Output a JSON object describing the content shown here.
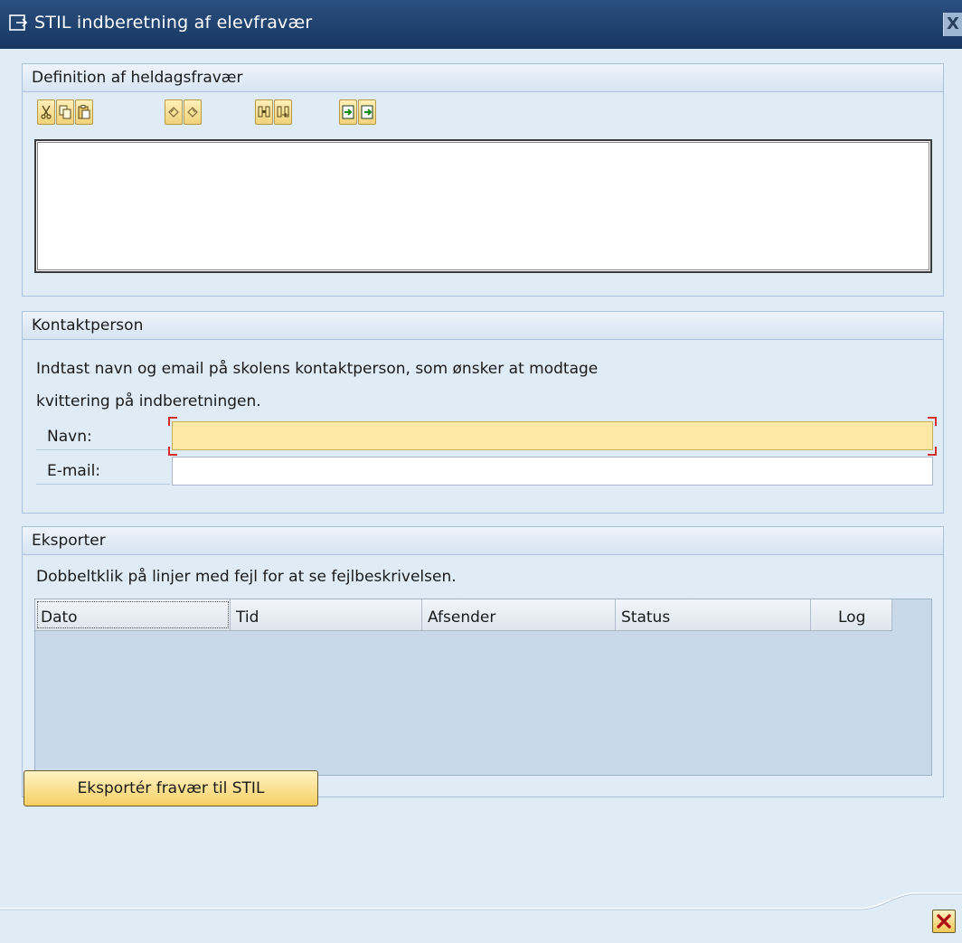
{
  "window": {
    "title": "STIL indberetning af elevfravær",
    "close_glyph": "X"
  },
  "definition_group": {
    "title": "Definition af heldagsfravær",
    "toolbar_icons": [
      "cut-icon",
      "copy-icon",
      "paste-icon",
      "undo-icon",
      "redo-icon",
      "find-icon",
      "find-next-icon",
      "load-local-file-icon",
      "save-local-file-icon"
    ],
    "editor_text": ""
  },
  "contact_group": {
    "title": "Kontaktperson",
    "instruction_line1": "Indtast navn og email på skolens kontaktperson, som ønsker at modtage",
    "instruction_line2": "kvittering på indberetningen.",
    "name_label": "Navn:",
    "name_value": "",
    "email_label": "E-mail:",
    "email_value": ""
  },
  "export_group": {
    "title": "Eksporter",
    "instruction": "Dobbeltklik på linjer med fejl for at se fejlbeskrivelsen.",
    "columns": [
      "Dato",
      "Tid",
      "Afsender",
      "Status",
      "Log"
    ],
    "rows": []
  },
  "actions": {
    "export_label": "Eksportér fravær til STIL",
    "cancel_icon": "cancel-icon"
  },
  "colors": {
    "titlebar": "#1f4470",
    "background": "#dfebf5",
    "required_field": "#fde8a6",
    "button": "#f5cf63",
    "table_body": "#c9d9ea"
  }
}
